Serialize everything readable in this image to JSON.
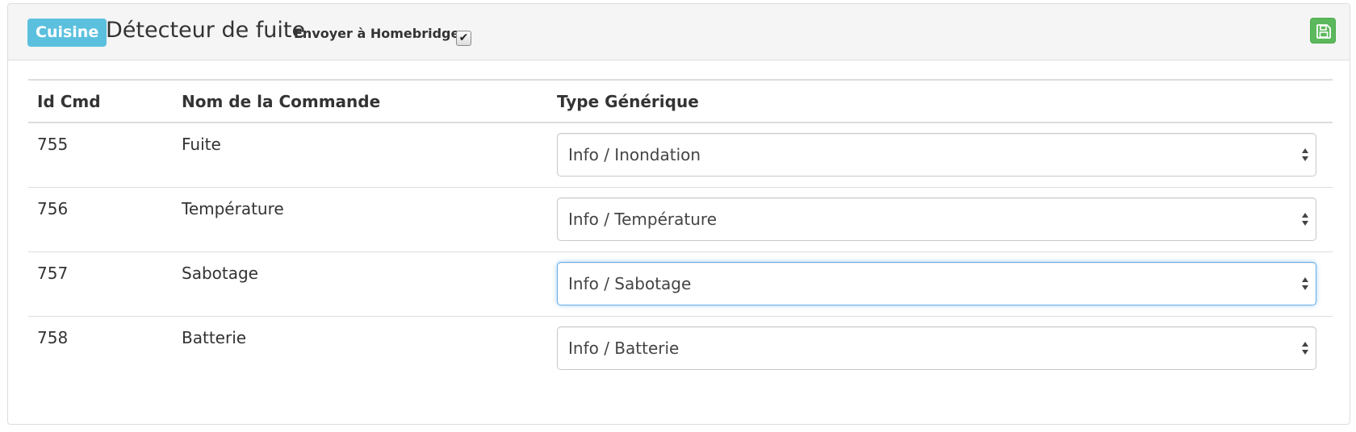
{
  "header": {
    "room_badge": "Cuisine",
    "device_title": "Détecteur de fuite",
    "homebridge_label": "Envoyer à Homebridge",
    "homebridge_checked": true,
    "save_icon": "floppy-disk-icon"
  },
  "table": {
    "columns": [
      "Id Cmd",
      "Nom de la Commande",
      "Type Générique"
    ],
    "rows": [
      {
        "id": "755",
        "name": "Fuite",
        "type": "Info / Inondation",
        "focused": false
      },
      {
        "id": "756",
        "name": "Température",
        "type": "Info / Température",
        "focused": false
      },
      {
        "id": "757",
        "name": "Sabotage",
        "type": "Info / Sabotage",
        "focused": true
      },
      {
        "id": "758",
        "name": "Batterie",
        "type": "Info / Batterie",
        "focused": false
      }
    ]
  },
  "colors": {
    "badge": "#5bc0de",
    "save_button": "#5cb85c",
    "focus_border": "#66afe9"
  }
}
